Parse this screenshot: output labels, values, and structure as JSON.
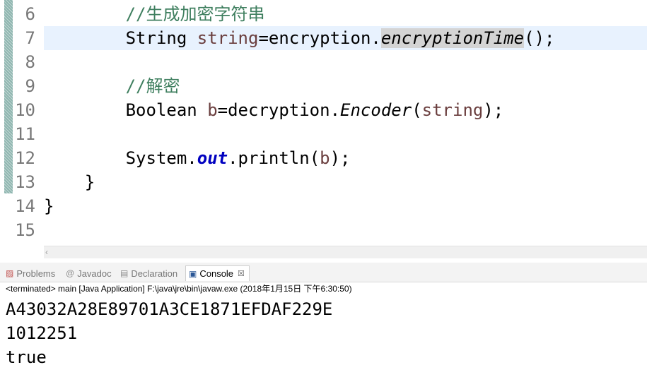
{
  "editor": {
    "line_numbers": [
      "6",
      "7",
      "8",
      "9",
      "10",
      "11",
      "12",
      "13",
      "14",
      "15"
    ],
    "lines": {
      "l6": {
        "indent": "        ",
        "comment": "//生成加密字符串"
      },
      "l7": {
        "indent": "        ",
        "type": "String ",
        "var": "string",
        "eq": "=encryption.",
        "method": "encryptionTime",
        "end": "();"
      },
      "l9": {
        "indent": "        ",
        "comment": "//解密"
      },
      "l10": {
        "indent": "        ",
        "type": "Boolean ",
        "var": "b",
        "eq": "=decryption.",
        "method": "Encoder",
        "open": "(",
        "arg": "string",
        "end": ");"
      },
      "l12": {
        "indent": "        ",
        "cls": "System.",
        "field": "out",
        "call": ".println(",
        "arg": "b",
        "end": ");"
      },
      "l13": {
        "text": "    }"
      },
      "l14": {
        "text": "}"
      }
    },
    "colors": {
      "comment": "#3f7f5f",
      "local_variable": "#6a3e3e",
      "static_field": "#0000c0",
      "current_line": "#e8f2fe"
    },
    "scroll_left_glyph": "‹"
  },
  "views": {
    "tabs": [
      {
        "label": "Problems",
        "icon": "problems-icon"
      },
      {
        "label": "Javadoc",
        "icon": "javadoc-icon"
      },
      {
        "label": "Declaration",
        "icon": "declaration-icon"
      },
      {
        "label": "Console",
        "icon": "console-icon",
        "active": true
      }
    ],
    "close_glyph": "☒",
    "console": {
      "status": "<terminated> main [Java Application] F:\\java\\jre\\bin\\javaw.exe (2018年1月15日 下午6:30:50)",
      "output": [
        "A43032A28E89701A3CE1871EFDAF229E",
        "1012251",
        "true"
      ]
    }
  }
}
